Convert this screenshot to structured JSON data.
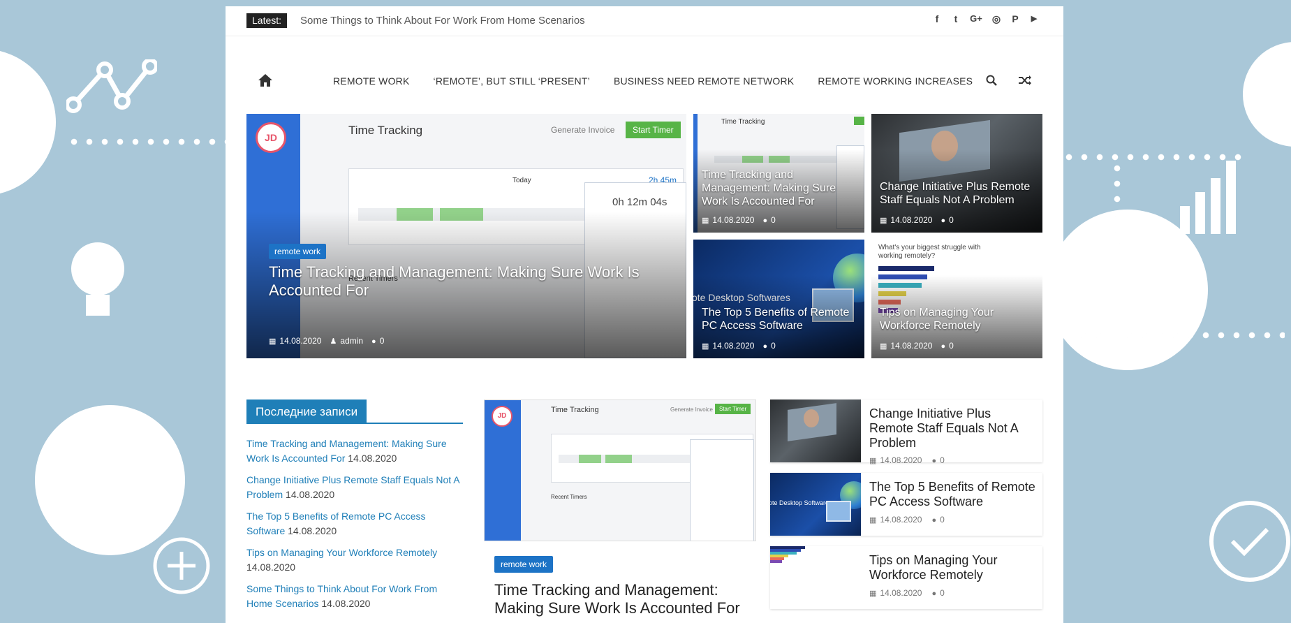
{
  "latest": {
    "badge": "Latest:",
    "text": "Some Things to Think About For Work From Home Scenarios"
  },
  "socials": [
    {
      "icon": "facebook-icon",
      "glyph": "f"
    },
    {
      "icon": "twitter-icon",
      "glyph": "t"
    },
    {
      "icon": "google-plus-icon",
      "glyph": "G+"
    },
    {
      "icon": "instagram-icon",
      "glyph": "◎"
    },
    {
      "icon": "pinterest-icon",
      "glyph": "P"
    },
    {
      "icon": "youtube-icon",
      "glyph": "▶"
    }
  ],
  "nav": {
    "items": [
      "REMOTE WORK",
      "‘REMOTE’, BUT STILL ‘PRESENT’",
      "BUSINESS NEED REMOTE NETWORK",
      "REMOTE WORKING INCREASES"
    ]
  },
  "featured": {
    "main": {
      "category": "remote work",
      "title": "Time Tracking and Management: Making Sure Work Is Accounted For",
      "date": "14.08.2020",
      "author": "admin",
      "comments": "0"
    },
    "tiles": [
      {
        "title": "Time Tracking and Management: Making Sure Work Is Accounted For",
        "date": "14.08.2020",
        "comments": "0"
      },
      {
        "title": "Change Initiative Plus Remote Staff Equals Not A Problem",
        "date": "14.08.2020",
        "comments": "0"
      },
      {
        "title": "The Top 5 Benefits of Remote PC Access Software",
        "date": "14.08.2020",
        "comments": "0"
      },
      {
        "title": "Tips on Managing Your Workforce Remotely",
        "date": "14.08.2020",
        "comments": "0"
      }
    ]
  },
  "shot_labels": {
    "time_tracking": "Time Tracking",
    "generate_invoice": "Generate Invoice",
    "start_timer": "Start Timer",
    "recent_timers": "Recent Timers",
    "today": "Today",
    "duration": "2h 45m",
    "timer": "0h 12m 04s",
    "jd": "JD",
    "remote_desktop": "ote Desktop Softwares",
    "struggle": "What's your biggest struggle with working remotely?"
  },
  "widget": {
    "title": "Последние записи",
    "items": [
      {
        "title": "Time Tracking and Management: Making Sure Work Is Accounted For",
        "date": "14.08.2020"
      },
      {
        "title": "Change Initiative Plus Remote Staff Equals Not A Problem",
        "date": "14.08.2020"
      },
      {
        "title": "The Top 5 Benefits of Remote PC Access Software",
        "date": "14.08.2020"
      },
      {
        "title": "Tips on Managing Your Workforce Remotely",
        "date": "14.08.2020"
      },
      {
        "title": "Some Things to Think About For Work From Home Scenarios",
        "date": "14.08.2020"
      }
    ]
  },
  "post": {
    "category": "remote work",
    "title": "Time Tracking and Management: Making Sure Work Is Accounted For"
  },
  "rlist": [
    {
      "title": "Change Initiative Plus Remote Staff Equals Not A Problem",
      "date": "14.08.2020",
      "comments": "0"
    },
    {
      "title": "The Top 5 Benefits of Remote PC Access Software",
      "date": "14.08.2020",
      "comments": "0"
    },
    {
      "title": "Tips on Managing Your Workforce Remotely",
      "date": "14.08.2020",
      "comments": "0"
    }
  ]
}
